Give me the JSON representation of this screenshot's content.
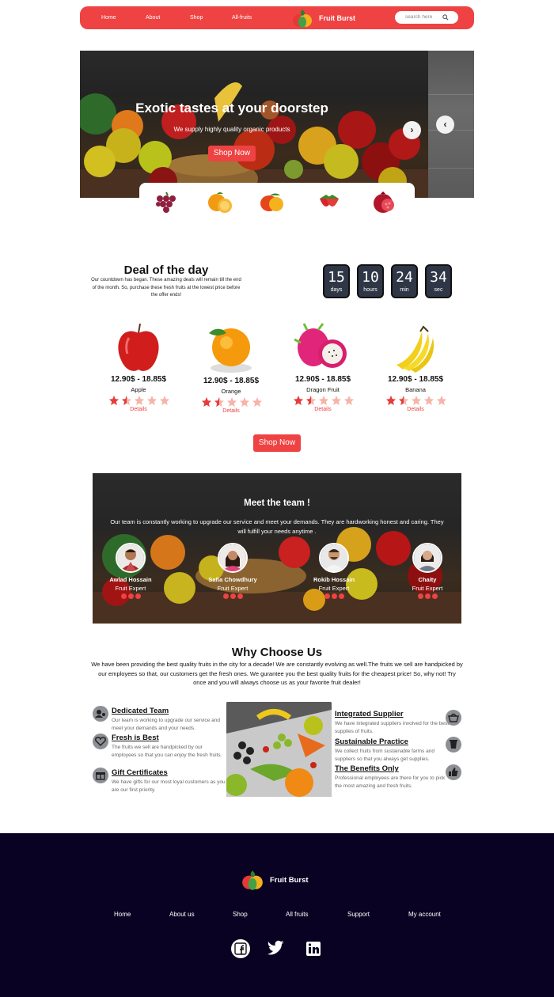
{
  "nav": {
    "links": [
      "Home",
      "About",
      "Shop",
      "All-fruits"
    ],
    "brand": "Fruit Burst",
    "search_placeholder": "search here"
  },
  "hero": {
    "title": "Exotic tastes at your doorstep",
    "subtitle": "We supply highly quality organic products",
    "button": "Shop Now",
    "next_arrow": "›",
    "prev_arrow": "‹"
  },
  "strip_fruits": [
    "grapes-icon",
    "orange-icon",
    "mango-icon",
    "strawberry-icon",
    "pomegranate-icon"
  ],
  "deal": {
    "title": "Deal of the day",
    "text": "Our countdown has began. These amazing deals will remain till the end of the month. So, purchase these fresh fruits at the lowest price before the offer ends!",
    "countdown": [
      {
        "value": "15",
        "label": "days"
      },
      {
        "value": "10",
        "label": "hours"
      },
      {
        "value": "24",
        "label": "min"
      },
      {
        "value": "34",
        "label": "sec"
      }
    ],
    "products": [
      {
        "price": "12.90$ - 18.85$",
        "name": "Apple",
        "details": "Details",
        "rating": 1.5
      },
      {
        "price": "12.90$ - 18.85$",
        "name": "Orange",
        "details": "Details",
        "rating": 1.5
      },
      {
        "price": "12.90$ - 18.85$",
        "name": "Dragon Fruit",
        "details": "Details",
        "rating": 1.5
      },
      {
        "price": "12.90$ - 18.85$",
        "name": "Banana",
        "details": "Details",
        "rating": 1.5
      }
    ],
    "shop_button": "Shop Now"
  },
  "team": {
    "title": "Meet the team !",
    "text": "Our team is constantly working to upgrade our service and meet your demands. They are hardworking honest and caring. They will fulfill your needs anytime .",
    "members": [
      {
        "name": "Awlad Hossain",
        "role": "Fruit Expert"
      },
      {
        "name": "Safia Chowdhury",
        "role": "Fruit Expert"
      },
      {
        "name": "Rokib Hossain",
        "role": "Fruit Expert"
      },
      {
        "name": "Chaity",
        "role": "Fruit Expert"
      }
    ]
  },
  "why": {
    "title": "Why Choose Us",
    "text": "We have been providing the best quality fruits in the city for a decade! We are constantly evolving as well.The fruits we sell are handpicked by our employees so that, our customers get the fresh ones. We gurantee you the best quality fruits for the cheapest price! So, why not! Try once and you will always choose us as your favorite fruit dealer!",
    "left": [
      {
        "title": "Dedicated Team",
        "text": "Our team is working to upgrade our service and meet your demands and your needs.",
        "icon": "team-icon"
      },
      {
        "title": "Fresh is Best",
        "text": "The fruits we sell are handpicked by our employees so that you can enjoy the fresh fruits.",
        "icon": "heart-icon"
      },
      {
        "title": "Gift Certificates",
        "text": "We have gifts for our most loyal customers as you are our first priority.",
        "icon": "gift-icon"
      }
    ],
    "right": [
      {
        "title": "Integrated Supplier",
        "text": "We have integrated suppliers involved for the best supplies of fruits.",
        "icon": "basket-icon"
      },
      {
        "title": "Sustainable Practice",
        "text": "We collect fruits from sustainable farms and suppliers so that you always get supplies.",
        "icon": "cup-icon"
      },
      {
        "title": "The Benefits Only",
        "text": "Professional employees are there for you to pick the most amazing and fresh fruits.",
        "icon": "thumbs-up-icon"
      }
    ]
  },
  "footer": {
    "brand": "Fruit Burst",
    "links": [
      "Home",
      "About us",
      "Shop",
      "All fruits",
      "Support",
      "My account"
    ],
    "social": [
      "facebook-icon",
      "twitter-icon",
      "linkedin-icon"
    ]
  },
  "colors": {
    "accent": "#ee4243",
    "footer_bg": "#0a0222",
    "countdown_bg": "#2f3746"
  }
}
